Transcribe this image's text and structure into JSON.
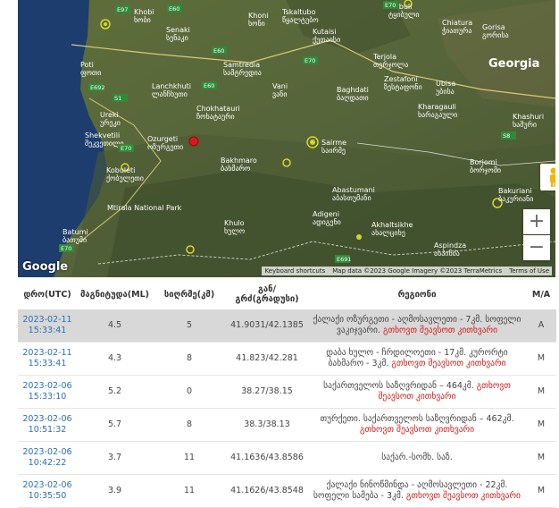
{
  "map": {
    "country_label": "Georgia",
    "labels": [
      {
        "name": "Khobi",
        "geo": "ხობი"
      },
      {
        "name": "Senaki",
        "geo": "სენაკი"
      },
      {
        "name": "Khoni",
        "geo": "ხონი"
      },
      {
        "name": "Tskaltubo",
        "geo": "წყალტუბო"
      },
      {
        "name": "Kutaisi",
        "geo": "ქუთაისი"
      },
      {
        "name": "Tkibuli",
        "geo": "ტყიბული"
      },
      {
        "name": "Chiatura",
        "geo": "ჭიათურა"
      },
      {
        "name": "Gorisa",
        "geo": "გორისა"
      },
      {
        "name": "Poti",
        "geo": "ფოთი"
      },
      {
        "name": "Samtredia",
        "geo": "სამტრედია"
      },
      {
        "name": "Terjola",
        "geo": "თერჯოლა"
      },
      {
        "name": "Lanchkhuti",
        "geo": "ლანჩხუთი"
      },
      {
        "name": "Vani",
        "geo": "ვანი"
      },
      {
        "name": "Zestafoni",
        "geo": "ზესტაფონი"
      },
      {
        "name": "Ubisa",
        "geo": "უბისა"
      },
      {
        "name": "Baghdati",
        "geo": "ბაღდათი"
      },
      {
        "name": "Ureki",
        "geo": "ურეკი"
      },
      {
        "name": "Chokhatauri",
        "geo": "ჩოხატაური"
      },
      {
        "name": "Kharagauli",
        "geo": "ხარაგაული"
      },
      {
        "name": "Khashuri",
        "geo": "ხაშური"
      },
      {
        "name": "Shekvetili",
        "geo": "შეკვეთილი"
      },
      {
        "name": "Ozurgeti",
        "geo": "ოზურგეთი"
      },
      {
        "name": "Sairme",
        "geo": "საირმე"
      },
      {
        "name": "Bakhmaro",
        "geo": "ბახმარო"
      },
      {
        "name": "Borjomi",
        "geo": "ბორჯომი"
      },
      {
        "name": "Kobuleti",
        "geo": "ქობულეთი"
      },
      {
        "name": "Abastumani",
        "geo": "აბასთუმანი"
      },
      {
        "name": "Bakuriani",
        "geo": "ბაკურიანი"
      },
      {
        "name": "Mtirala National Park",
        "geo": ""
      },
      {
        "name": "Adigeni",
        "geo": "ადიგენი"
      },
      {
        "name": "Batumi",
        "geo": "ბათუმი"
      },
      {
        "name": "Khulo",
        "geo": "ხულო"
      },
      {
        "name": "Akhaltsikhe",
        "geo": "ახალციხე"
      },
      {
        "name": "Aspindza",
        "geo": "ასპინძა"
      }
    ],
    "roads": [
      "E97",
      "E60",
      "E60",
      "E70",
      "E692",
      "E60",
      "E70",
      "E70",
      "S8",
      "E691",
      "E70",
      "S1"
    ],
    "google_logo": "Google",
    "attribution": {
      "shortcuts": "Keyboard shortcuts",
      "data": "Map data ©2023 Google Imagery ©2023 TerraMetrics",
      "terms": "Terms of Use"
    },
    "controls": {
      "zoom_in": "+",
      "zoom_out": "−"
    },
    "colors": {
      "epicenter": "#e0161b",
      "marker": "#d4d82a",
      "water": "#1c3d6e"
    }
  },
  "table": {
    "headers": {
      "date": "დრო(UTC)",
      "magnitude": "მაგნიტუდა(ML)",
      "depth": "სიღრმე(კმ)",
      "coords_line1": "გან/",
      "coords_line2": "გრძ(გრადუსი)",
      "region": "რეგიონი",
      "ma": "M/A"
    },
    "rows": [
      {
        "date": "2023-02-11",
        "time": "15:33:41",
        "mag": "4.5",
        "depth": "5",
        "coords": "41.9031/42.1385",
        "region": "ქალაქი ოზურგეთი - აღმოსავლეთი - 7კმ. სოფელი ვაკიჯვარი.",
        "link": "გთხოვთ შეავსოთ კითხვარი",
        "ma": "A"
      },
      {
        "date": "2023-02-11",
        "time": "15:33:41",
        "mag": "4.3",
        "depth": "8",
        "coords": "41.823/42.281",
        "region": "დაბა ხულო - ჩრდილოეთი - 17კმ. კურორტი ბახმარო - 3კმ.",
        "link": "გთხოვთ შეავსოთ კითხვარი",
        "ma": "M"
      },
      {
        "date": "2023-02-06",
        "time": "15:33:10",
        "mag": "5.2",
        "depth": "0",
        "coords": "38.27/38.15",
        "region": "საქართველოს საზღვრიდან – 464კმ.",
        "link": "გთხოვთ შეავსოთ კითხვარი",
        "ma": "M"
      },
      {
        "date": "2023-02-06",
        "time": "10:51:32",
        "mag": "5.7",
        "depth": "8",
        "coords": "38.3/38.13",
        "region": "თურქეთი. საქართველოს საზღვრიდან – 462კმ.",
        "link": "გთხოვთ შეავსოთ კითხვარი",
        "ma": "M"
      },
      {
        "date": "2023-02-06",
        "time": "10:42:22",
        "mag": "3.7",
        "depth": "11",
        "coords": "41.1636/43.8586",
        "region": "საქარ.-სომხ. საზ.",
        "link": "",
        "ma": "M"
      },
      {
        "date": "2023-02-06",
        "time": "10:35:50",
        "mag": "3.9",
        "depth": "11",
        "coords": "41.1626/43.8548",
        "region": "ქალაქი ნინოწმინდა - აღმოსავლეთი - 22კმ. სოფელი სამება - 3კმ.",
        "link": "გთხოვთ შეავსოთ კითხვარი",
        "ma": "M"
      }
    ]
  }
}
